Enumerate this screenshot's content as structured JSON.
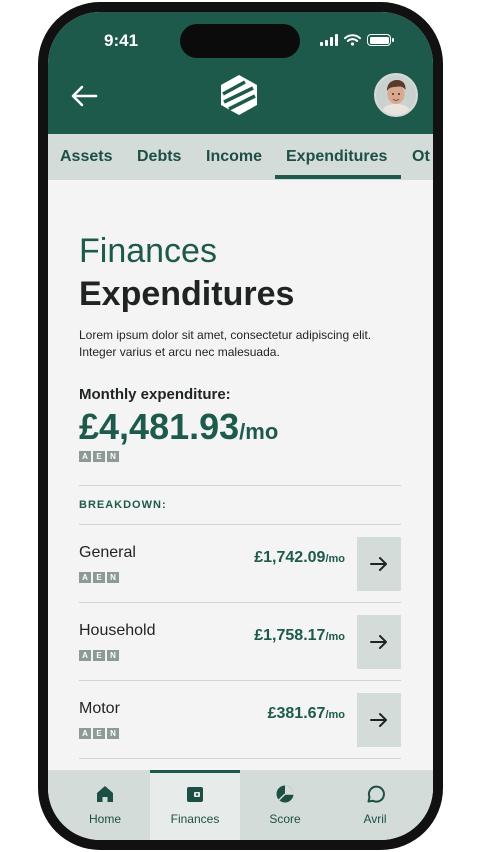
{
  "status_bar": {
    "time": "9:41"
  },
  "tabs": [
    "Assets",
    "Debts",
    "Income",
    "Expenditures",
    "Ot"
  ],
  "active_tab": "Expenditures",
  "page": {
    "section": "Finances",
    "title": "Expenditures",
    "description": "Lorem ipsum dolor sit amet, consectetur adipiscing elit. Integer varius et arcu nec malesuada."
  },
  "monthly": {
    "label": "Monthly expenditure:",
    "amount": "£4,481.93",
    "unit": "/mo",
    "tags": [
      "A",
      "E",
      "N"
    ]
  },
  "breakdown": {
    "label": "BREAKDOWN:",
    "items": [
      {
        "name": "General",
        "amount": "£1,742.09",
        "unit": "/mo",
        "tags": [
          "A",
          "E",
          "N"
        ]
      },
      {
        "name": "Household",
        "amount": "£1,758.17",
        "unit": "/mo",
        "tags": [
          "A",
          "E",
          "N"
        ]
      },
      {
        "name": "Motor",
        "amount": "£381.67",
        "unit": "/mo",
        "tags": [
          "A",
          "E",
          "N"
        ]
      }
    ]
  },
  "bottom_nav": [
    {
      "label": "Home",
      "icon": "home-icon"
    },
    {
      "label": "Finances",
      "icon": "wallet-icon",
      "active": true
    },
    {
      "label": "Score",
      "icon": "score-chart-icon"
    },
    {
      "label": "Avril",
      "icon": "chat-bubble-icon"
    }
  ],
  "colors": {
    "brand": "#1d5a4c",
    "tab_bar": "#d4dcda",
    "background": "#f3f4f3",
    "tag": "#8e9a97"
  }
}
